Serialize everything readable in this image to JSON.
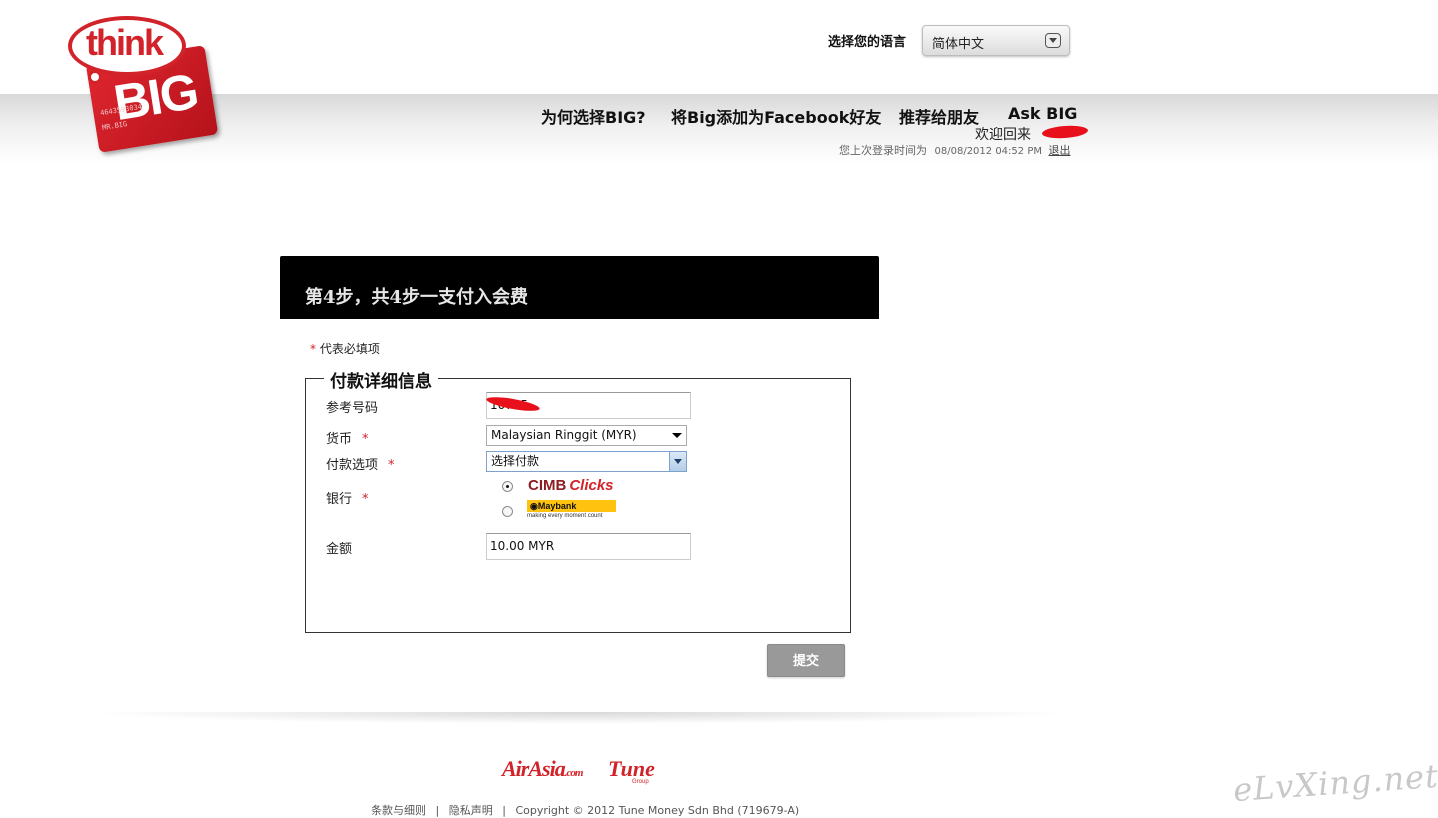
{
  "logo": {
    "think": "think",
    "big": "BIG",
    "card_number": "4643593034",
    "card_name": "MR.BIG"
  },
  "language": {
    "label": "选择您的语言",
    "selected": "简体中文"
  },
  "nav": {
    "items": [
      {
        "label": "为何选择BIG?"
      },
      {
        "label": "将Big添加为Facebook好友"
      },
      {
        "label": "推荐给朋友"
      },
      {
        "label": "Ask BIG"
      }
    ]
  },
  "user": {
    "welcome": "欢迎回来",
    "last_login_label": "您上次登录时间为",
    "last_login_time": "08/08/2012 04:52 PM",
    "logout": "退出"
  },
  "step": {
    "title": "第4步，共4步一支付入会费"
  },
  "form": {
    "required_star": "*",
    "required_note": "代表必填项",
    "legend": "付款详细信息",
    "reference": {
      "label": "参考号码",
      "value": "10725"
    },
    "currency": {
      "label": "货币",
      "value": "Malaysian Ringgit (MYR)"
    },
    "payment_option": {
      "label": "付款选项",
      "value": "选择付款"
    },
    "bank": {
      "label": "银行",
      "options": [
        {
          "name": "CIMB",
          "suffix": "Clicks",
          "checked": true
        },
        {
          "name": "Maybank",
          "tagline": "making every moment count",
          "checked": false
        }
      ]
    },
    "amount": {
      "label": "金额",
      "value": "10.00 MYR"
    },
    "submit": "提交"
  },
  "footer": {
    "airasia": "AirAsia",
    "airasia_com": ".com",
    "tune": "Tune",
    "tune_group": "Group",
    "links": [
      "条款与细则",
      "隐私声明"
    ],
    "separator": "|",
    "copyright": "Copyright © 2012 Tune Money Sdn Bhd (719679-A)"
  },
  "watermark": "eLvXing.net",
  "colors": {
    "brand_red": "#d2232a",
    "step_bar": "#000000",
    "button_gray": "#999999"
  }
}
